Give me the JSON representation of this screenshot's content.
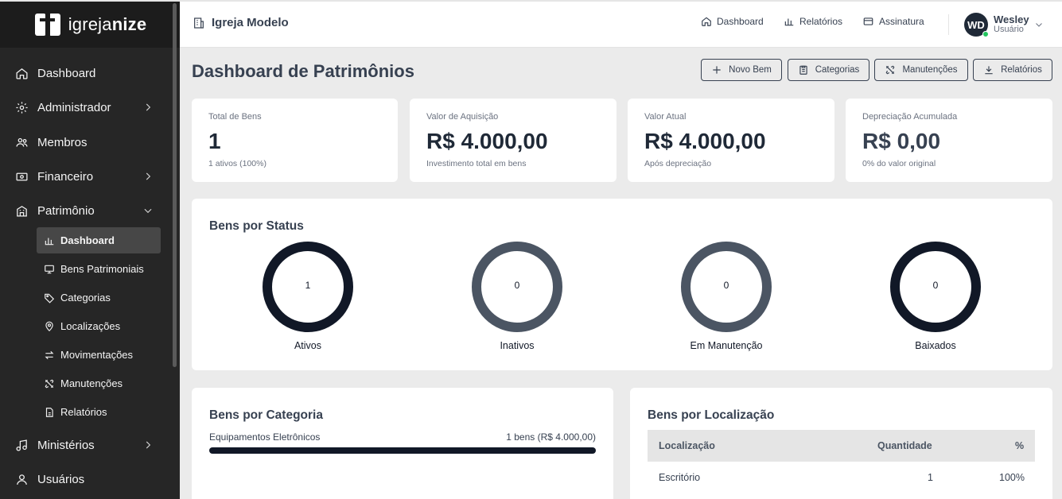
{
  "brand": {
    "name_light": "igreja",
    "name_bold": "nize"
  },
  "sidebar": {
    "items": [
      {
        "label": "Dashboard",
        "icon": "home-icon"
      },
      {
        "label": "Administrador",
        "icon": "gear-icon",
        "expandable": true
      },
      {
        "label": "Membros",
        "icon": "users-icon"
      },
      {
        "label": "Financeiro",
        "icon": "money-icon",
        "expandable": true
      },
      {
        "label": "Patrimônio",
        "icon": "building-icon",
        "expanded": true
      },
      {
        "label": "Ministérios",
        "icon": "music-icon",
        "expandable": true
      },
      {
        "label": "Usuários",
        "icon": "user-icon"
      }
    ],
    "subitems": [
      {
        "label": "Dashboard",
        "icon": "bar-chart-icon",
        "active": true
      },
      {
        "label": "Bens Patrimoniais",
        "icon": "monitor-icon"
      },
      {
        "label": "Categorias",
        "icon": "tag-icon"
      },
      {
        "label": "Localizações",
        "icon": "map-pin-icon"
      },
      {
        "label": "Movimentações",
        "icon": "arrows-icon"
      },
      {
        "label": "Manutenções",
        "icon": "tools-icon"
      },
      {
        "label": "Relatórios",
        "icon": "file-icon"
      }
    ]
  },
  "topbar": {
    "org_name": "Igreja Modelo",
    "links": [
      {
        "label": "Dashboard",
        "icon": "home-icon"
      },
      {
        "label": "Relatórios",
        "icon": "bar-chart-icon"
      },
      {
        "label": "Assinatura",
        "icon": "credit-card-icon"
      }
    ],
    "user": {
      "initials": "WD",
      "name": "Wesley",
      "role": "Usuário"
    }
  },
  "page": {
    "title": "Dashboard de Patrimônios",
    "buttons": [
      {
        "label": "Novo Bem",
        "icon": "plus-icon"
      },
      {
        "label": "Categorias",
        "icon": "clipboard-icon"
      },
      {
        "label": "Manutenções",
        "icon": "tools-icon"
      },
      {
        "label": "Relatórios",
        "icon": "download-icon"
      }
    ]
  },
  "stats": [
    {
      "label": "Total de Bens",
      "value": "1",
      "sub": "1 ativos (100%)"
    },
    {
      "label": "Valor de Aquisição",
      "value": "R$ 4.000,00",
      "sub": "Investimento total em bens"
    },
    {
      "label": "Valor Atual",
      "value": "R$ 4.000,00",
      "sub": "Após depreciação"
    },
    {
      "label": "Depreciação Acumulada",
      "value": "R$ 0,00",
      "sub": "0% do valor original"
    }
  ],
  "status_section": {
    "title": "Bens por Status",
    "items": [
      {
        "label": "Ativos",
        "count": "1",
        "color": "#111827"
      },
      {
        "label": "Inativos",
        "count": "0",
        "color": "#4b5563"
      },
      {
        "label": "Em Manutenção",
        "count": "0",
        "color": "#4b5563"
      },
      {
        "label": "Baixados",
        "count": "0",
        "color": "#111827"
      }
    ]
  },
  "category_section": {
    "title": "Bens por Categoria",
    "rows": [
      {
        "name": "Equipamentos Eletrônicos",
        "summary": "1 bens (R$ 4.000,00)",
        "share": 1.0
      }
    ]
  },
  "location_section": {
    "title": "Bens por Localização",
    "columns": [
      "Localização",
      "Quantidade",
      "%"
    ],
    "rows": [
      [
        "Escritório",
        "1",
        "100%"
      ]
    ]
  },
  "colors": {
    "sidebar_bg": "#262626",
    "accent_dark": "#111827",
    "page_bg": "#ebebeb"
  }
}
